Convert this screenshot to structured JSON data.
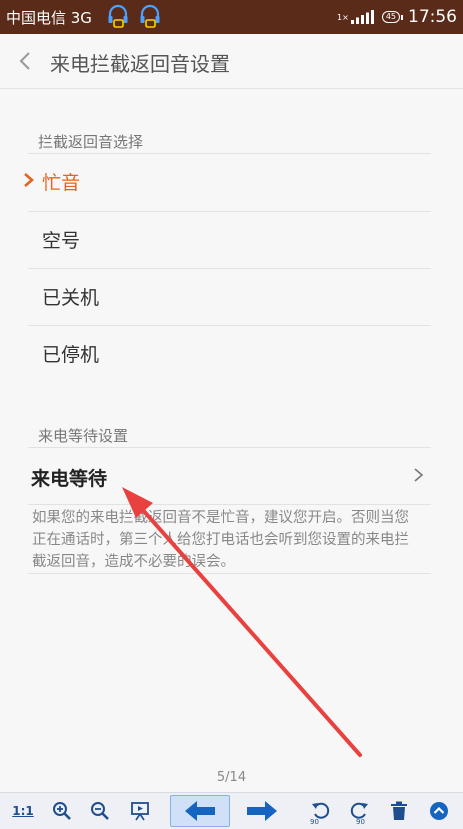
{
  "status": {
    "carrier": "中国电信 3G",
    "net": "1×",
    "battery": "45",
    "time": "17:56"
  },
  "nav": {
    "title": "来电拦截返回音设置"
  },
  "section1": {
    "title": "拦截返回音选择",
    "options": [
      {
        "label": "忙音",
        "selected": true
      },
      {
        "label": "空号",
        "selected": false
      },
      {
        "label": "已关机",
        "selected": false
      },
      {
        "label": "已停机",
        "selected": false
      }
    ]
  },
  "section2": {
    "title": "来电等待设置",
    "row": {
      "label": "来电等待"
    },
    "desc": "如果您的来电拦截返回音不是忙音，建议您开启。否则当您正在通话时，第三个人给您打电话也会听到您设置的来电拦截返回音，造成不必要的误会。"
  },
  "viewer": {
    "page_indicator": "5/14",
    "toolbar": {
      "actual_size": "1:1",
      "rotate_label": "90"
    }
  },
  "colors": {
    "accent": "#e6621f",
    "annotation_arrow": "#e8413f",
    "statusbar": "#5b2b1a"
  },
  "icons": [
    "back-chevron-icon",
    "selected-check-icon",
    "chevron-right-icon",
    "zoom-in-icon",
    "zoom-out-icon",
    "slideshow-icon",
    "prev-arrow-icon",
    "next-arrow-icon",
    "rotate-left-icon",
    "rotate-right-icon",
    "delete-icon",
    "scroll-up-icon"
  ]
}
